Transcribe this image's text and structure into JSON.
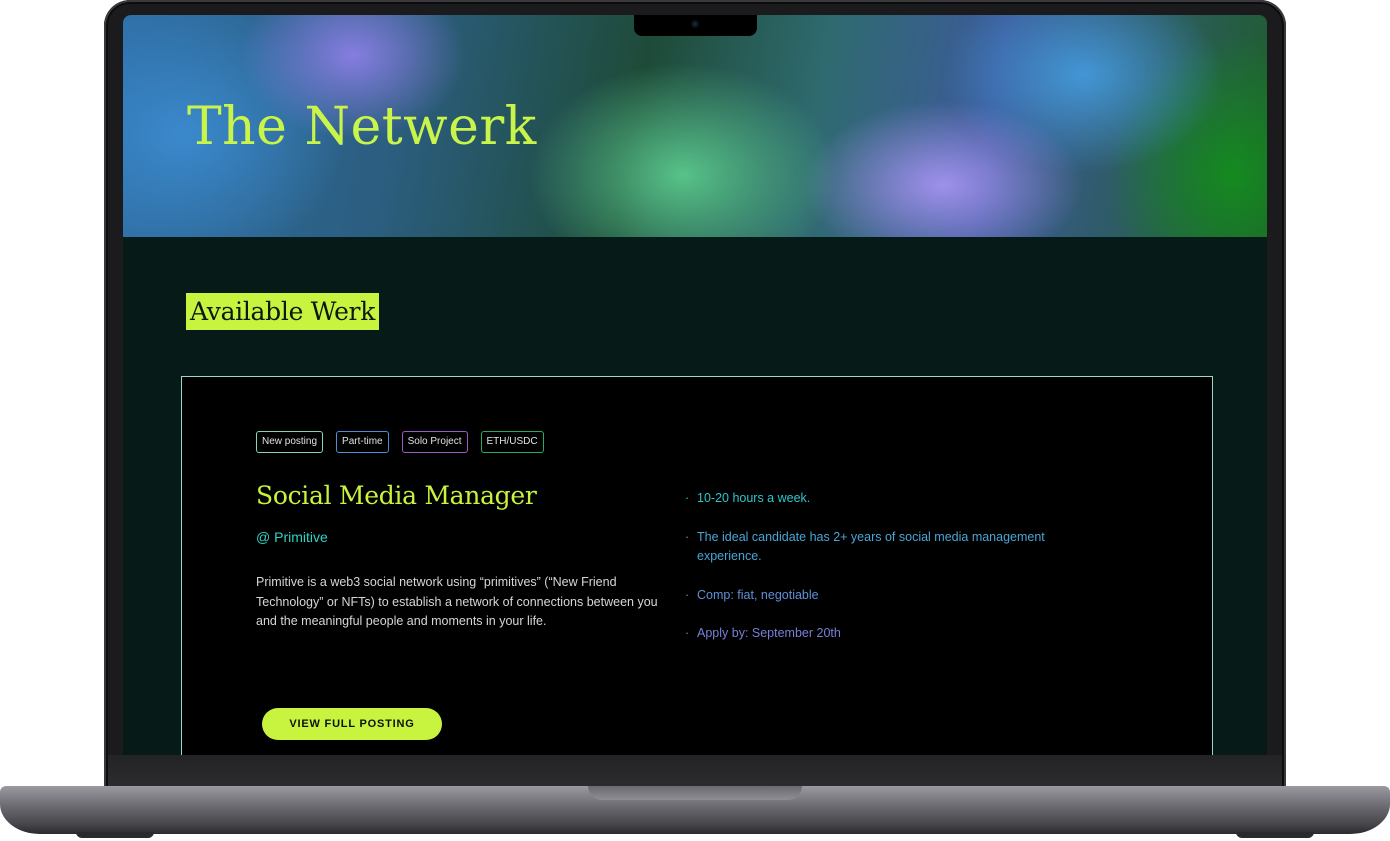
{
  "hero": {
    "title": "The Netwerk"
  },
  "section": {
    "title": "Available Werk"
  },
  "job": {
    "tags": [
      {
        "label": "New posting",
        "color": "#7fd8b2"
      },
      {
        "label": "Part-time",
        "color": "#4a8fd8"
      },
      {
        "label": "Solo Project",
        "color": "#9a5bc8"
      },
      {
        "label": "ETH/USDC",
        "color": "#2aa86a"
      }
    ],
    "title": "Social Media Manager",
    "company": "@ Primitive",
    "description": "Primitive is a web3 social network using “primitives” (“New Friend Technology” or NFTs) to establish a network of connections between you and the meaningful people and moments in your life.",
    "bullets": [
      {
        "text": "10-20 hours a week.",
        "color": "#2fc6c9"
      },
      {
        "text": "The ideal candidate has 2+ years of social media management experience.",
        "color": "#4aa6d6"
      },
      {
        "text": "Comp: fiat, negotiable",
        "color": "#5f8fd8"
      },
      {
        "text": "Apply by: September 20th",
        "color": "#7a7fd8"
      }
    ],
    "cta_label": "VIEW FULL POSTING"
  },
  "colors": {
    "accent": "#c8f33f",
    "background": "#061a18",
    "card": "#000000"
  }
}
